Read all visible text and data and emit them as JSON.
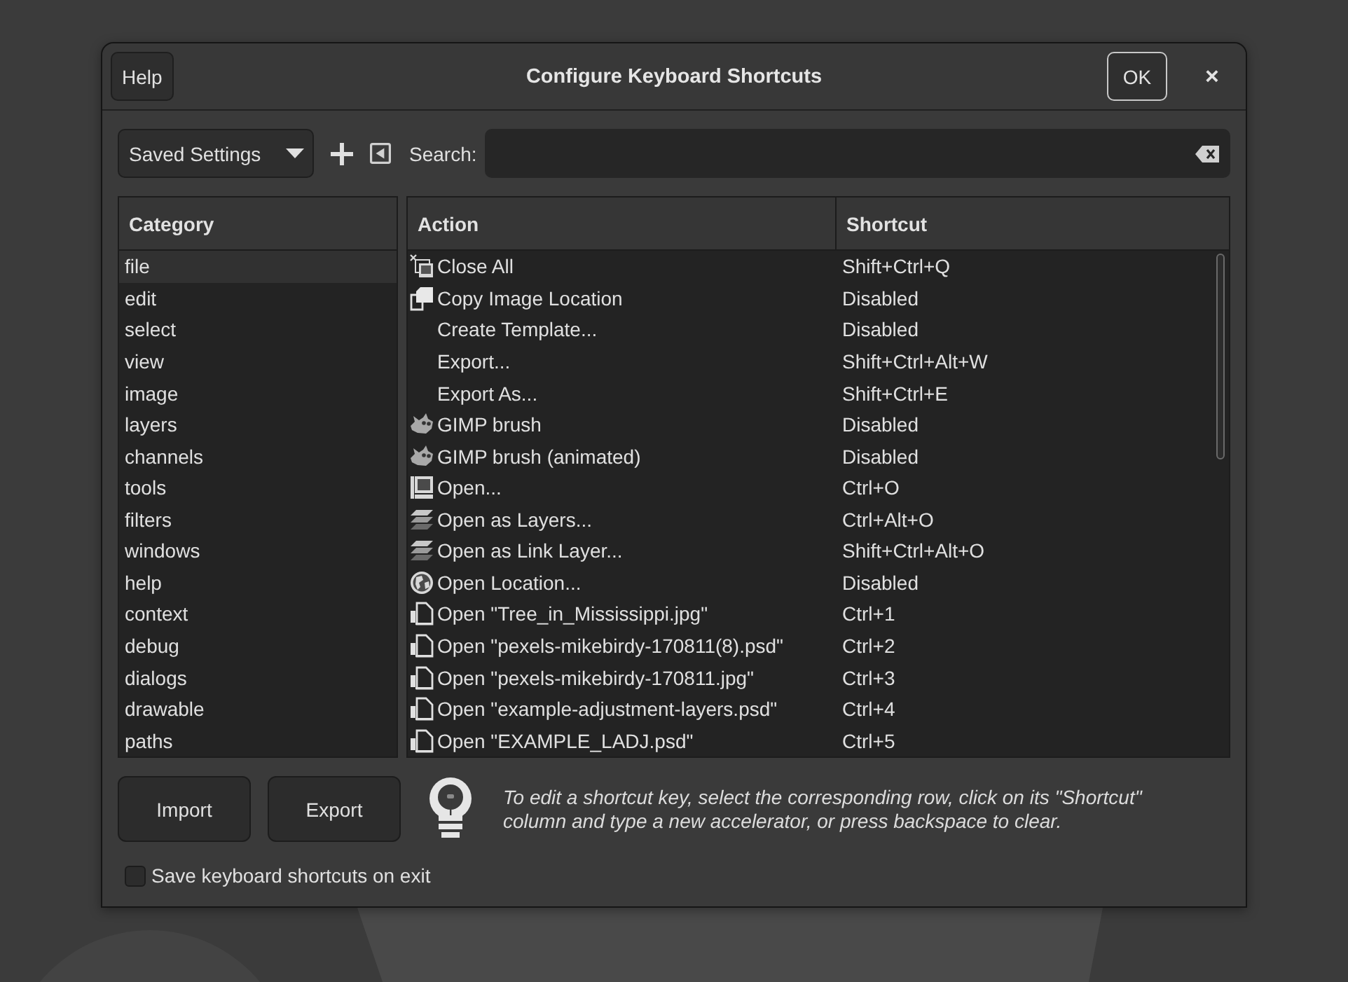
{
  "window": {
    "title": "Configure Keyboard Shortcuts",
    "help_button": "Help",
    "ok_button": "OK",
    "close_button": "×"
  },
  "toolbar": {
    "saved_settings": "Saved Settings",
    "search_label": "Search:"
  },
  "categories": {
    "header": "Category",
    "items": [
      {
        "label": "file",
        "selected": true
      },
      {
        "label": "edit",
        "selected": false
      },
      {
        "label": "select",
        "selected": false
      },
      {
        "label": "view",
        "selected": false
      },
      {
        "label": "image",
        "selected": false
      },
      {
        "label": "layers",
        "selected": false
      },
      {
        "label": "channels",
        "selected": false
      },
      {
        "label": "tools",
        "selected": false
      },
      {
        "label": "filters",
        "selected": false
      },
      {
        "label": "windows",
        "selected": false
      },
      {
        "label": "help",
        "selected": false
      },
      {
        "label": "context",
        "selected": false
      },
      {
        "label": "debug",
        "selected": false
      },
      {
        "label": "dialogs",
        "selected": false
      },
      {
        "label": "drawable",
        "selected": false
      },
      {
        "label": "paths",
        "selected": false
      }
    ]
  },
  "actions": {
    "columns": [
      "Action",
      "Shortcut"
    ],
    "rows": [
      {
        "kind": "closeall",
        "action": "Close All",
        "shortcut": "Shift+Ctrl+Q"
      },
      {
        "kind": "copy",
        "action": "Copy Image Location",
        "shortcut": "Disabled"
      },
      {
        "kind": "none",
        "action": "Create Template...",
        "shortcut": "Disabled"
      },
      {
        "kind": "none",
        "action": "Export...",
        "shortcut": "Shift+Ctrl+Alt+W"
      },
      {
        "kind": "none",
        "action": "Export As...",
        "shortcut": "Shift+Ctrl+E"
      },
      {
        "kind": "brush",
        "action": "GIMP brush",
        "shortcut": "Disabled"
      },
      {
        "kind": "brush",
        "action": "GIMP brush (animated)",
        "shortcut": "Disabled"
      },
      {
        "kind": "open",
        "action": "Open...",
        "shortcut": "Ctrl+O"
      },
      {
        "kind": "layers",
        "action": "Open as Layers...",
        "shortcut": "Ctrl+Alt+O"
      },
      {
        "kind": "layers",
        "action": "Open as Link Layer...",
        "shortcut": "Shift+Ctrl+Alt+O"
      },
      {
        "kind": "globe",
        "action": "Open Location...",
        "shortcut": "Disabled"
      },
      {
        "kind": "recent",
        "action": "Open \"Tree_in_Mississippi.jpg\"",
        "shortcut": "Ctrl+1"
      },
      {
        "kind": "recent",
        "action": "Open \"pexels-mikebirdy-170811(8).psd\"",
        "shortcut": "Ctrl+2"
      },
      {
        "kind": "recent",
        "action": "Open \"pexels-mikebirdy-170811.jpg\"",
        "shortcut": "Ctrl+3"
      },
      {
        "kind": "recent",
        "action": "Open \"example-adjustment-layers.psd\"",
        "shortcut": "Ctrl+4"
      },
      {
        "kind": "recent",
        "action": "Open \"EXAMPLE_LADJ.psd\"",
        "shortcut": "Ctrl+5"
      }
    ]
  },
  "footer": {
    "buttons": [
      "Import",
      "Export"
    ],
    "hint": "To edit a shortcut key, select the corresponding row, click on its \"Shortcut\" column and type a new accelerator, or press backspace to clear.",
    "save_on_exit": {
      "label": "Save keyboard shortcuts on exit",
      "checked": false
    }
  }
}
